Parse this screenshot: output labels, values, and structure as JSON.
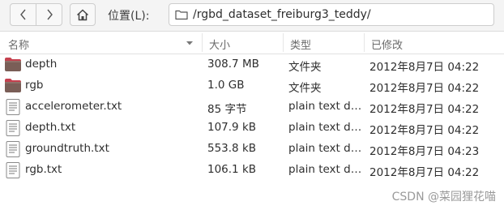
{
  "toolbar": {
    "location_label": "位置(L):",
    "path": "/rgbd_dataset_freiburg3_teddy/"
  },
  "columns": {
    "name": "名称",
    "size": "大小",
    "type": "类型",
    "modified": "已修改"
  },
  "files": [
    {
      "name": "depth",
      "size": "308.7 MB",
      "type": "文件夹",
      "modified": "2012年8月7日 04:22",
      "icon": "folder-icon"
    },
    {
      "name": "rgb",
      "size": "1.0 GB",
      "type": "文件夹",
      "modified": "2012年8月7日 04:22",
      "icon": "folder-icon"
    },
    {
      "name": "accelerometer.txt",
      "size": "85 字节",
      "type": "plain text document",
      "modified": "2012年8月7日 04:22",
      "icon": "text-file-icon"
    },
    {
      "name": "depth.txt",
      "size": "107.9 kB",
      "type": "plain text document",
      "modified": "2012年8月7日 04:22",
      "icon": "text-file-icon"
    },
    {
      "name": "groundtruth.txt",
      "size": "553.8 kB",
      "type": "plain text document",
      "modified": "2012年8月7日 04:23",
      "icon": "text-file-icon"
    },
    {
      "name": "rgb.txt",
      "size": "106.1 kB",
      "type": "plain text document",
      "modified": "2012年8月7日 04:22",
      "icon": "text-file-icon"
    }
  ],
  "watermark": "CSDN @菜园狸花喵",
  "colors": {
    "folder": "#7a5e57",
    "folder_tab": "#c5414f",
    "toolbar_bg": "#f4f4f4"
  }
}
